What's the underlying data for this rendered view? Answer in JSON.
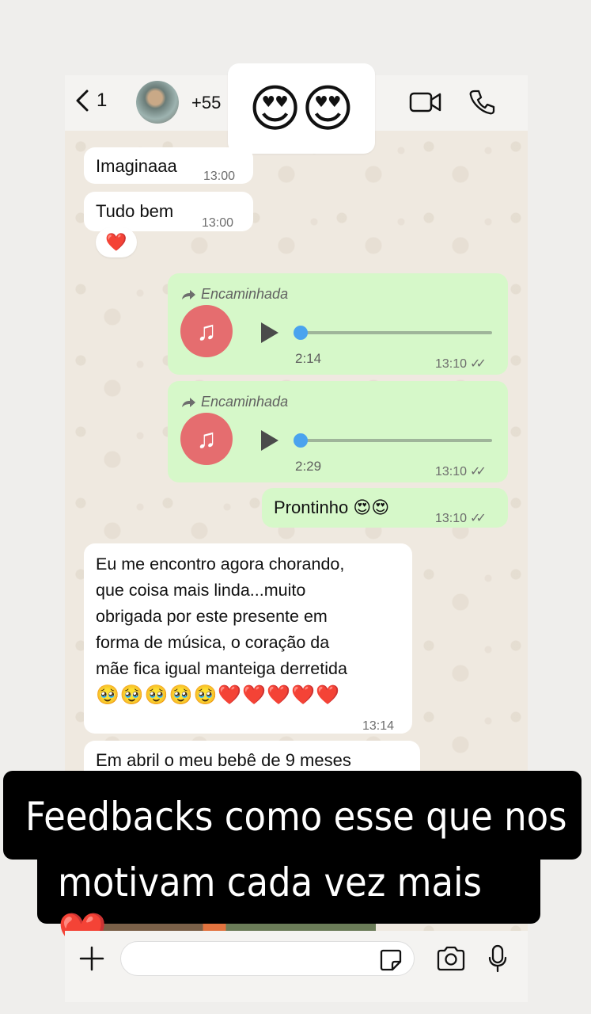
{
  "header": {
    "back_count": "1",
    "contact": "+55",
    "reaction": "😍😍"
  },
  "messages": {
    "m1": {
      "text": "Imaginaaa",
      "time": "13:00"
    },
    "m2": {
      "text": "Tudo bem",
      "time": "13:00",
      "reaction": "❤️"
    },
    "audio1": {
      "forwarded": "Encaminhada",
      "duration": "2:14",
      "time": "13:10",
      "progress": 0
    },
    "audio2": {
      "forwarded": "Encaminhada",
      "duration": "2:29",
      "time": "13:10",
      "progress": 0
    },
    "m3": {
      "text": "Prontinho 😍😍",
      "time": "13:10"
    },
    "m4": {
      "lines": [
        "Eu me encontro agora chorando,",
        "que coisa mais linda...muito",
        "obrigada por este presente em",
        "forma de música, o coração da",
        "mãe fica igual manteiga derretida",
        "🥹🥹🥹🥹🥹❤️❤️❤️❤️❤️"
      ],
      "time": "13:14"
    },
    "m5": {
      "text": "Em abril o meu bebê de 9 meses"
    }
  },
  "caption": {
    "line1": "Feedbacks como esse que nos",
    "line2": "motivam cada vez mais ❤️"
  },
  "icons": {
    "back": "chevron-left-icon",
    "video": "video-call-icon",
    "phone": "phone-icon",
    "plus": "plus-icon",
    "sticker": "sticker-icon",
    "camera": "camera-icon",
    "mic": "microphone-icon"
  },
  "colors": {
    "outgoing_bubble": "#d6f8c9",
    "incoming_bubble": "#ffffff",
    "audio_avatar": "#e56d6f",
    "audio_knob": "#4aa3ee"
  }
}
